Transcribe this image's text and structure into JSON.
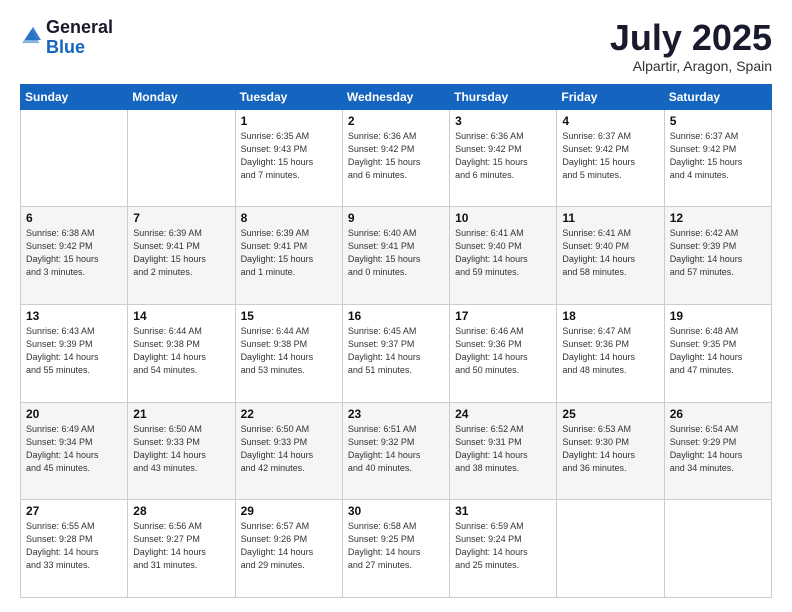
{
  "logo": {
    "general": "General",
    "blue": "Blue"
  },
  "header": {
    "month": "July 2025",
    "location": "Alpartir, Aragon, Spain"
  },
  "weekdays": [
    "Sunday",
    "Monday",
    "Tuesday",
    "Wednesday",
    "Thursday",
    "Friday",
    "Saturday"
  ],
  "weeks": [
    [
      {
        "day": "",
        "info": ""
      },
      {
        "day": "",
        "info": ""
      },
      {
        "day": "1",
        "info": "Sunrise: 6:35 AM\nSunset: 9:43 PM\nDaylight: 15 hours\nand 7 minutes."
      },
      {
        "day": "2",
        "info": "Sunrise: 6:36 AM\nSunset: 9:42 PM\nDaylight: 15 hours\nand 6 minutes."
      },
      {
        "day": "3",
        "info": "Sunrise: 6:36 AM\nSunset: 9:42 PM\nDaylight: 15 hours\nand 6 minutes."
      },
      {
        "day": "4",
        "info": "Sunrise: 6:37 AM\nSunset: 9:42 PM\nDaylight: 15 hours\nand 5 minutes."
      },
      {
        "day": "5",
        "info": "Sunrise: 6:37 AM\nSunset: 9:42 PM\nDaylight: 15 hours\nand 4 minutes."
      }
    ],
    [
      {
        "day": "6",
        "info": "Sunrise: 6:38 AM\nSunset: 9:42 PM\nDaylight: 15 hours\nand 3 minutes."
      },
      {
        "day": "7",
        "info": "Sunrise: 6:39 AM\nSunset: 9:41 PM\nDaylight: 15 hours\nand 2 minutes."
      },
      {
        "day": "8",
        "info": "Sunrise: 6:39 AM\nSunset: 9:41 PM\nDaylight: 15 hours\nand 1 minute."
      },
      {
        "day": "9",
        "info": "Sunrise: 6:40 AM\nSunset: 9:41 PM\nDaylight: 15 hours\nand 0 minutes."
      },
      {
        "day": "10",
        "info": "Sunrise: 6:41 AM\nSunset: 9:40 PM\nDaylight: 14 hours\nand 59 minutes."
      },
      {
        "day": "11",
        "info": "Sunrise: 6:41 AM\nSunset: 9:40 PM\nDaylight: 14 hours\nand 58 minutes."
      },
      {
        "day": "12",
        "info": "Sunrise: 6:42 AM\nSunset: 9:39 PM\nDaylight: 14 hours\nand 57 minutes."
      }
    ],
    [
      {
        "day": "13",
        "info": "Sunrise: 6:43 AM\nSunset: 9:39 PM\nDaylight: 14 hours\nand 55 minutes."
      },
      {
        "day": "14",
        "info": "Sunrise: 6:44 AM\nSunset: 9:38 PM\nDaylight: 14 hours\nand 54 minutes."
      },
      {
        "day": "15",
        "info": "Sunrise: 6:44 AM\nSunset: 9:38 PM\nDaylight: 14 hours\nand 53 minutes."
      },
      {
        "day": "16",
        "info": "Sunrise: 6:45 AM\nSunset: 9:37 PM\nDaylight: 14 hours\nand 51 minutes."
      },
      {
        "day": "17",
        "info": "Sunrise: 6:46 AM\nSunset: 9:36 PM\nDaylight: 14 hours\nand 50 minutes."
      },
      {
        "day": "18",
        "info": "Sunrise: 6:47 AM\nSunset: 9:36 PM\nDaylight: 14 hours\nand 48 minutes."
      },
      {
        "day": "19",
        "info": "Sunrise: 6:48 AM\nSunset: 9:35 PM\nDaylight: 14 hours\nand 47 minutes."
      }
    ],
    [
      {
        "day": "20",
        "info": "Sunrise: 6:49 AM\nSunset: 9:34 PM\nDaylight: 14 hours\nand 45 minutes."
      },
      {
        "day": "21",
        "info": "Sunrise: 6:50 AM\nSunset: 9:33 PM\nDaylight: 14 hours\nand 43 minutes."
      },
      {
        "day": "22",
        "info": "Sunrise: 6:50 AM\nSunset: 9:33 PM\nDaylight: 14 hours\nand 42 minutes."
      },
      {
        "day": "23",
        "info": "Sunrise: 6:51 AM\nSunset: 9:32 PM\nDaylight: 14 hours\nand 40 minutes."
      },
      {
        "day": "24",
        "info": "Sunrise: 6:52 AM\nSunset: 9:31 PM\nDaylight: 14 hours\nand 38 minutes."
      },
      {
        "day": "25",
        "info": "Sunrise: 6:53 AM\nSunset: 9:30 PM\nDaylight: 14 hours\nand 36 minutes."
      },
      {
        "day": "26",
        "info": "Sunrise: 6:54 AM\nSunset: 9:29 PM\nDaylight: 14 hours\nand 34 minutes."
      }
    ],
    [
      {
        "day": "27",
        "info": "Sunrise: 6:55 AM\nSunset: 9:28 PM\nDaylight: 14 hours\nand 33 minutes."
      },
      {
        "day": "28",
        "info": "Sunrise: 6:56 AM\nSunset: 9:27 PM\nDaylight: 14 hours\nand 31 minutes."
      },
      {
        "day": "29",
        "info": "Sunrise: 6:57 AM\nSunset: 9:26 PM\nDaylight: 14 hours\nand 29 minutes."
      },
      {
        "day": "30",
        "info": "Sunrise: 6:58 AM\nSunset: 9:25 PM\nDaylight: 14 hours\nand 27 minutes."
      },
      {
        "day": "31",
        "info": "Sunrise: 6:59 AM\nSunset: 9:24 PM\nDaylight: 14 hours\nand 25 minutes."
      },
      {
        "day": "",
        "info": ""
      },
      {
        "day": "",
        "info": ""
      }
    ]
  ]
}
